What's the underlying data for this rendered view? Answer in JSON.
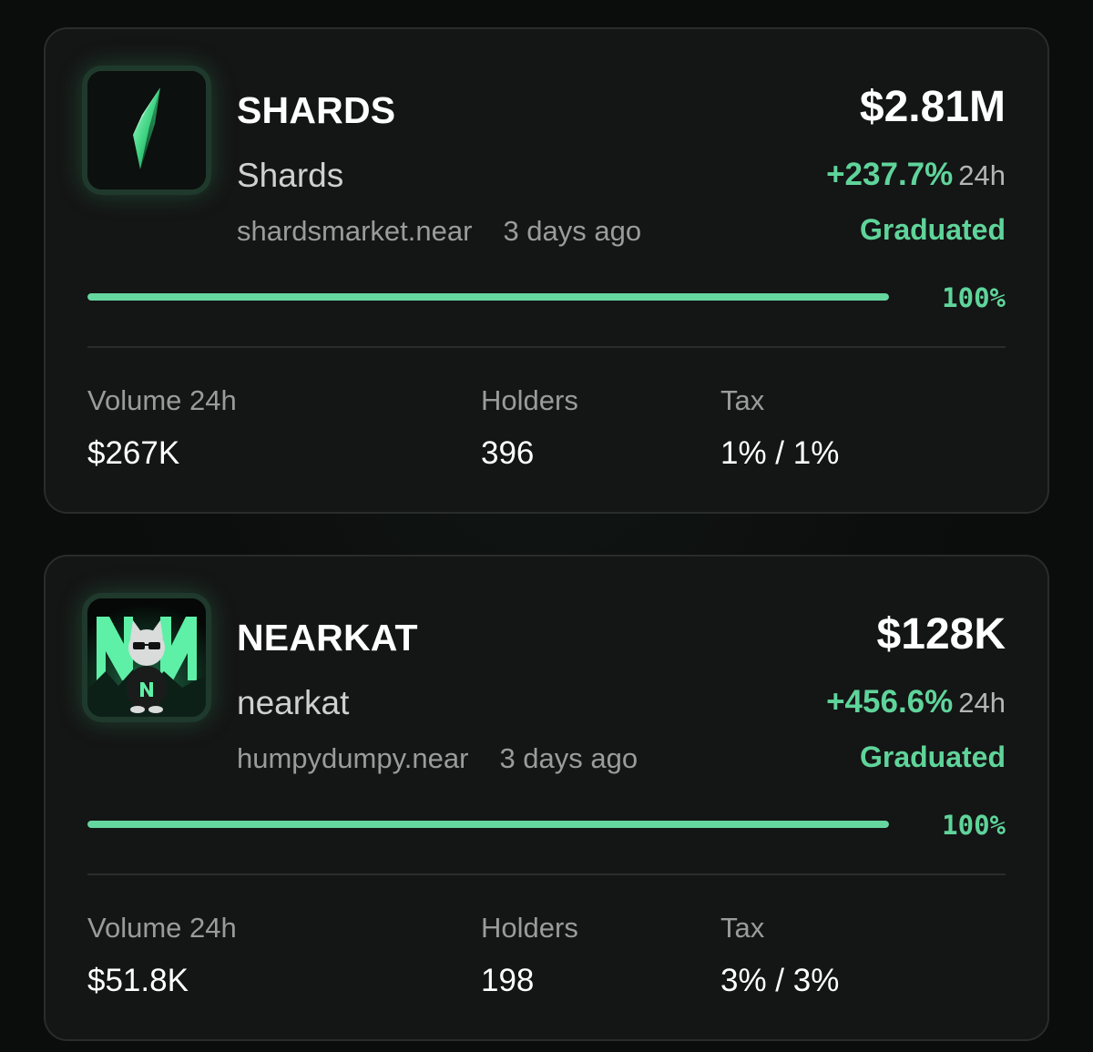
{
  "tokens": [
    {
      "ticker": "SHARDS",
      "name": "Shards",
      "creator": "shardsmarket.near",
      "time_ago": "3 days ago",
      "market_cap": "$2.81M",
      "change": "+237.7%",
      "change_period": "24h",
      "status": "Graduated",
      "progress_percent": 100,
      "progress_label": "100%",
      "stats": {
        "volume_label": "Volume 24h",
        "volume_value": "$267K",
        "holders_label": "Holders",
        "holders_value": "396",
        "tax_label": "Tax",
        "tax_value": "1% / 1%"
      },
      "logo_icon": "green-crystal-shard-icon"
    },
    {
      "ticker": "NEARKAT",
      "name": "nearkat",
      "creator": "humpydumpy.near",
      "time_ago": "3 days ago",
      "market_cap": "$128K",
      "change": "+456.6%",
      "change_period": "24h",
      "status": "Graduated",
      "progress_percent": 100,
      "progress_label": "100%",
      "stats": {
        "volume_label": "Volume 24h",
        "volume_value": "$51.8K",
        "holders_label": "Holders",
        "holders_value": "198",
        "tax_label": "Tax",
        "tax_value": "3% / 3%"
      },
      "logo_icon": "near-cat-mascot-icon"
    }
  ],
  "colors": {
    "accent_green": "#5fd49a",
    "card_bg": "#141515",
    "page_bg": "#0b0c0c"
  }
}
